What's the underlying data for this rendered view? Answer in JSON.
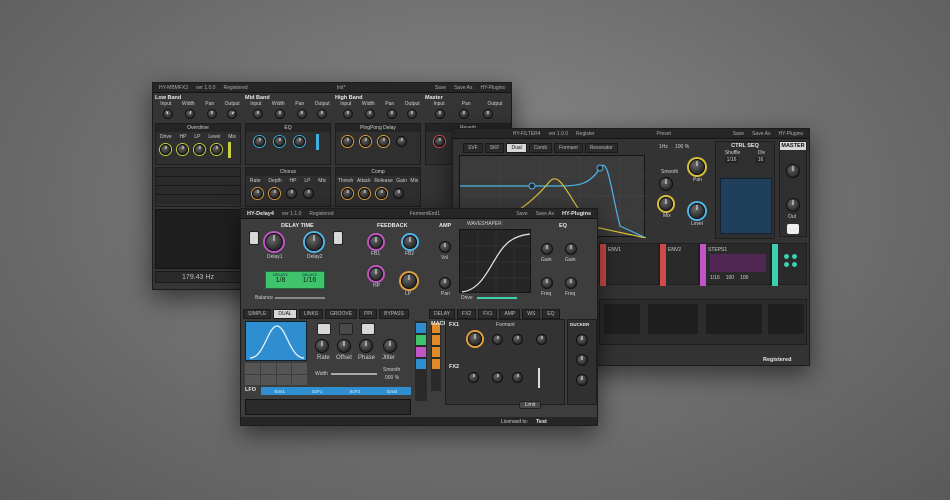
{
  "multiband": {
    "title": "HY-MBMFX3",
    "version": "ver 1.0.0",
    "registered": "Registered",
    "preset": "Init*",
    "save": "Save",
    "save_as": "Save As",
    "brand": "HY-Plugins",
    "bands": [
      "Low Band",
      "Mid Band",
      "High Band",
      "Master"
    ],
    "band_params": [
      "Input",
      "Width",
      "Pan",
      "Output"
    ],
    "fx_slots": [
      "Overdrive",
      "EQ",
      "PingPong Delay",
      "Reverb",
      "Chorus",
      "Comp"
    ],
    "knob_labels_a": [
      "Drive",
      "HP",
      "LP",
      "Level",
      "Mix"
    ],
    "knob_labels_b": [
      "Rate",
      "Depth",
      "HP",
      "LP",
      "Mix"
    ],
    "knob_labels_c": [
      "Thresh",
      "Attack",
      "Release",
      "Gain",
      "Mix"
    ],
    "crossover": "179.43 Hz"
  },
  "filter": {
    "title": "HY-FILTER4",
    "version": "ver 1.0.0",
    "registered": "Register",
    "preset": "Preset",
    "save": "Save",
    "save_as": "Save As",
    "brand": "HY-Plugins",
    "modes": [
      "SVF",
      "SKF",
      "Dual",
      "Comb",
      "Formant",
      "Resonator"
    ],
    "active_mode": "Dual",
    "osc": "1Hz",
    "zoom": "100 %",
    "ctrl_seq": "CTRL SEQ",
    "shuffle": "Shuffle",
    "div": "Div",
    "seq_div": "1/16",
    "seq_steps": "16",
    "master": "MASTER",
    "knob_labels": [
      "Smooth",
      "Pan",
      "Mix",
      "Level",
      "Out"
    ],
    "mod_labels": [
      "ENV1",
      "ENV2",
      "STEPS1"
    ],
    "mod_values": [
      "1/16",
      "100",
      "100"
    ],
    "footer": "Registered"
  },
  "delay": {
    "title": "HY-Delay4",
    "version": "ver 1.1.0",
    "registered": "Registered",
    "preset": "FermentEnd1",
    "save": "Save",
    "save_as": "Save As",
    "brand": "HY-Plugins",
    "delay_time": "DELAY TIME",
    "feedback": "FEEDBACK",
    "amp": "AMP",
    "eq": "EQ",
    "waveshaper": "WAVESHAPER",
    "delay1": "Delay1",
    "delay2": "Delay2",
    "delay1_mode": "DELAY1",
    "delay2_mode": "DELAY2",
    "delay1_value": "1/8",
    "delay2_value": "1/16",
    "balance": "Balance",
    "fb1": "FB1",
    "fb2": "FB2",
    "hp": "HP",
    "lp": "LP",
    "vol": "Vol",
    "pan": "Pan",
    "gain": "Gain",
    "freq": "Freq",
    "drive": "Drive",
    "modes": [
      "SIMPLE",
      "DUAL",
      "LINKS",
      "GROOVE",
      "PPI",
      "BYPASS"
    ],
    "active_mode": "DUAL",
    "chain": [
      "DELAY",
      "FX2",
      "FX1",
      "AMP",
      "WS",
      "EQ"
    ],
    "lfo": "LFO",
    "lfo_params": [
      "Rate",
      "Offset",
      "Phase",
      "Jitter"
    ],
    "width": "Width",
    "smooth": "Smooth",
    "smooth_value": "000 %",
    "macro": "MACRO",
    "fx1": "FX1",
    "fx2": "FX2",
    "formant": "Formant",
    "ducker": "DUCKER",
    "lfo_targets": [
      "Env1",
      "ScF1",
      "ScF2",
      "Env2"
    ],
    "limit": "Limit",
    "licensed": "Licensed to:",
    "user": "Test"
  }
}
